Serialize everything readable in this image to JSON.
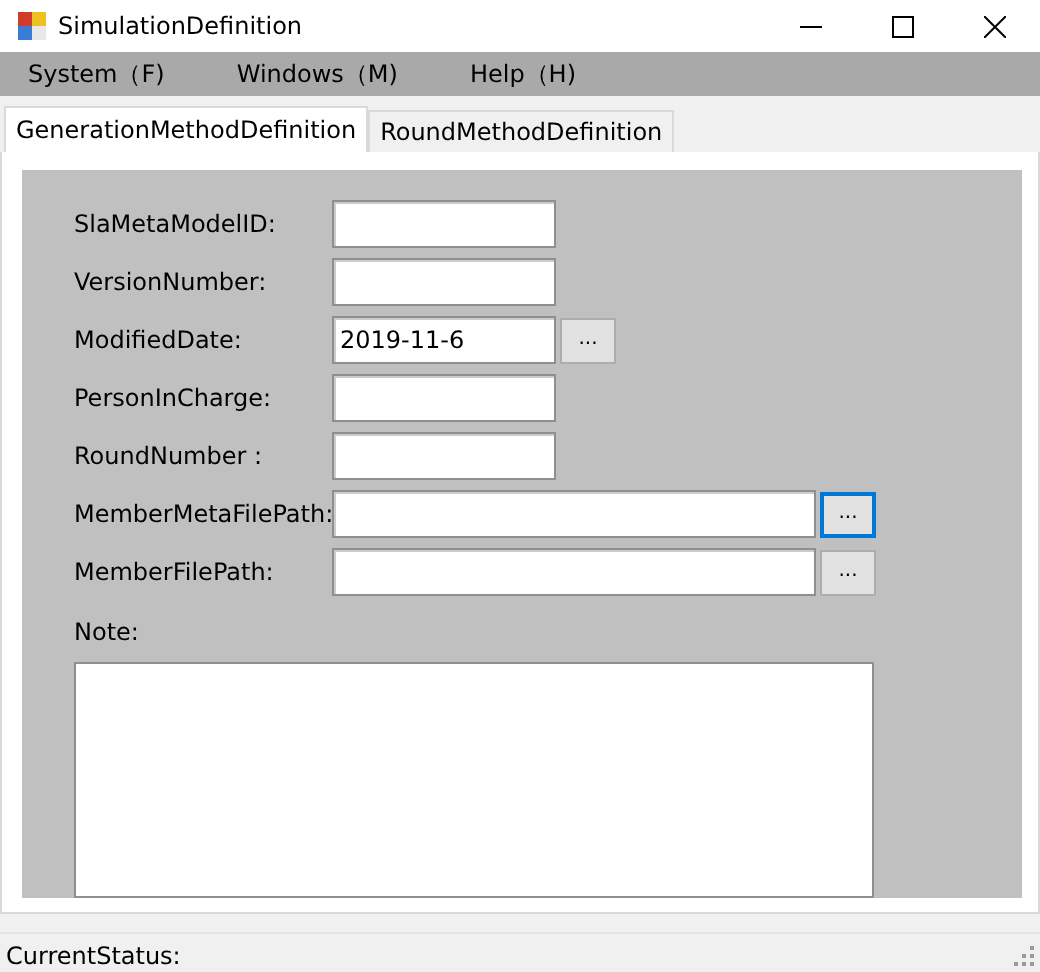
{
  "window": {
    "title": "SimulationDefinition"
  },
  "menu": [
    {
      "label": "System（F)"
    },
    {
      "label": "Windows（M)"
    },
    {
      "label": "Help（H)"
    }
  ],
  "tabs": [
    {
      "label": "GenerationMethodDefinition",
      "selected": true
    },
    {
      "label": "RoundMethodDefinition",
      "selected": false
    }
  ],
  "fields": [
    {
      "label": "SlaMetaModelID:",
      "kind": "short"
    },
    {
      "label": "VersionNumber:",
      "kind": "short"
    },
    {
      "label": "ModifiedDate:",
      "kind": "short",
      "value": "2019-11-6",
      "button": {
        "label": "...",
        "focused": false
      }
    },
    {
      "label": "PersonInCharge:",
      "kind": "short"
    },
    {
      "label": "RoundNumber :",
      "kind": "short"
    },
    {
      "label": "MemberMetaFilePath:",
      "kind": "long",
      "button": {
        "label": "...",
        "focused": true
      }
    },
    {
      "label": "MemberFilePath:",
      "kind": "long",
      "button": {
        "label": "...",
        "focused": false
      }
    }
  ],
  "note": {
    "label": "Note:"
  },
  "status_bar": {
    "text": "CurrentStatus:"
  }
}
